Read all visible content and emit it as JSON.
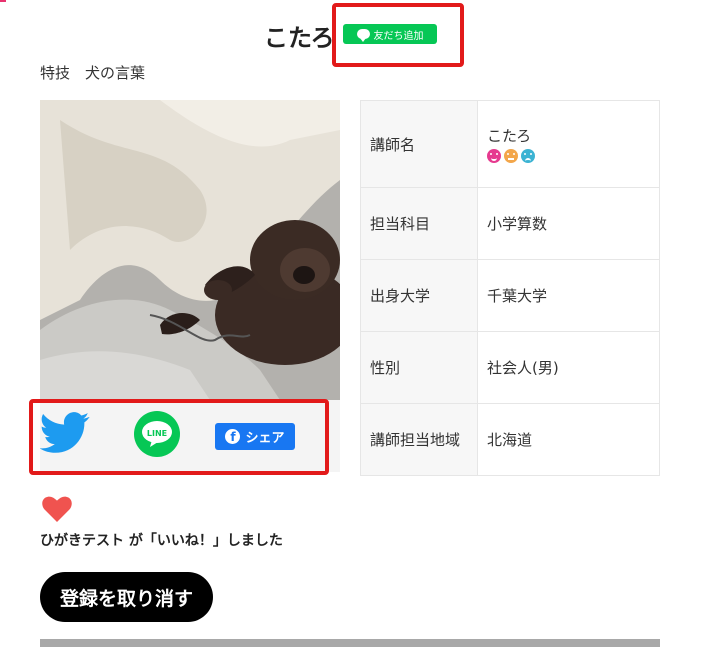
{
  "profile": {
    "name": "こたろ",
    "line_add_label": "友だち追加",
    "skill": "特技　犬の言葉"
  },
  "share": {
    "twitter_icon": "twitter-bird-icon",
    "line_label": "LINE",
    "facebook_label": "シェア"
  },
  "info_table": {
    "rows": [
      {
        "label": "講師名",
        "value": "こたろ"
      },
      {
        "label": "担当科目",
        "value": "小学算数"
      },
      {
        "label": "出身大学",
        "value": "千葉大学"
      },
      {
        "label": "性別",
        "value": "社会人(男)"
      },
      {
        "label": "講師担当地域",
        "value": "北海道"
      }
    ],
    "rating_icons": [
      "smile-face-icon",
      "neutral-face-icon",
      "sad-face-icon"
    ]
  },
  "like": {
    "heart_icon": "heart-icon",
    "text": "ひがきテスト が「いいね！」しました"
  },
  "actions": {
    "unregister_label": "登録を取り消す"
  },
  "colors": {
    "line_green": "#06c755",
    "facebook_blue": "#1877f2",
    "twitter_blue": "#1d9bf0",
    "highlight_red": "#e21a1a",
    "heart_red": "#f0534f"
  }
}
